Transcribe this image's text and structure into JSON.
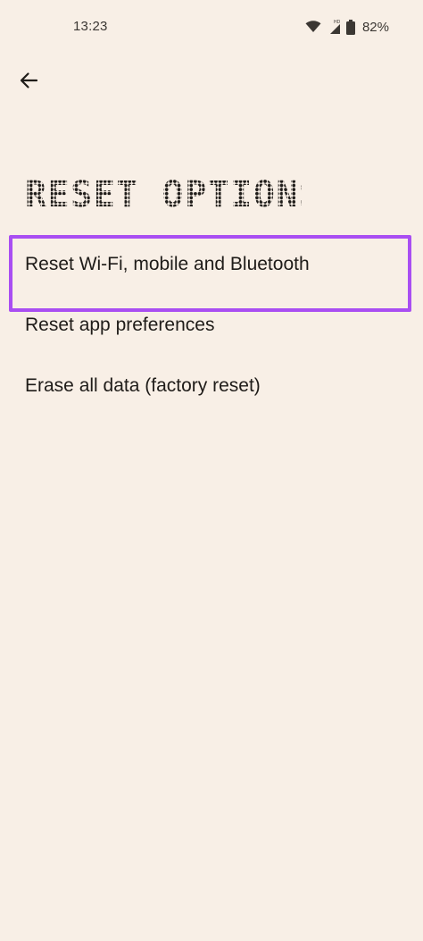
{
  "status_bar": {
    "time": "13:23",
    "battery_percent": "82%",
    "icons": [
      "wifi-icon",
      "hd-signal-icon",
      "battery-icon"
    ]
  },
  "header": {
    "back_icon": "arrow-back-icon",
    "title": "RESET OPTIONS"
  },
  "options": [
    {
      "label": "Reset Wi-Fi, mobile and Bluetooth",
      "highlighted": true
    },
    {
      "label": "Reset app preferences",
      "highlighted": false
    },
    {
      "label": "Erase all data (factory reset)",
      "highlighted": false
    }
  ],
  "colors": {
    "background": "#f8efe6",
    "highlight": "#a94ef2",
    "text": "#1f1c19"
  }
}
